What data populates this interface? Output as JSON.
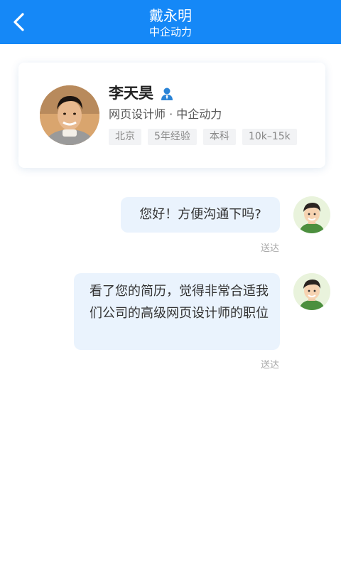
{
  "header": {
    "title": "戴永明",
    "subtitle": "中企动力"
  },
  "profile": {
    "name": "李天昊",
    "position": "网页设计师 · 中企动力",
    "tags": [
      "北京",
      "5年经验",
      "本科",
      "10k–15k"
    ]
  },
  "messages": [
    {
      "text": "您好！方便沟通下吗?",
      "status": "送达"
    },
    {
      "text": "看了您的简历，觉得非常合适我们公司的高级网页设计师的职位",
      "status": "送达"
    }
  ],
  "colors": {
    "header_bg": "#1588f7",
    "bubble_bg": "#eaf3fd"
  }
}
